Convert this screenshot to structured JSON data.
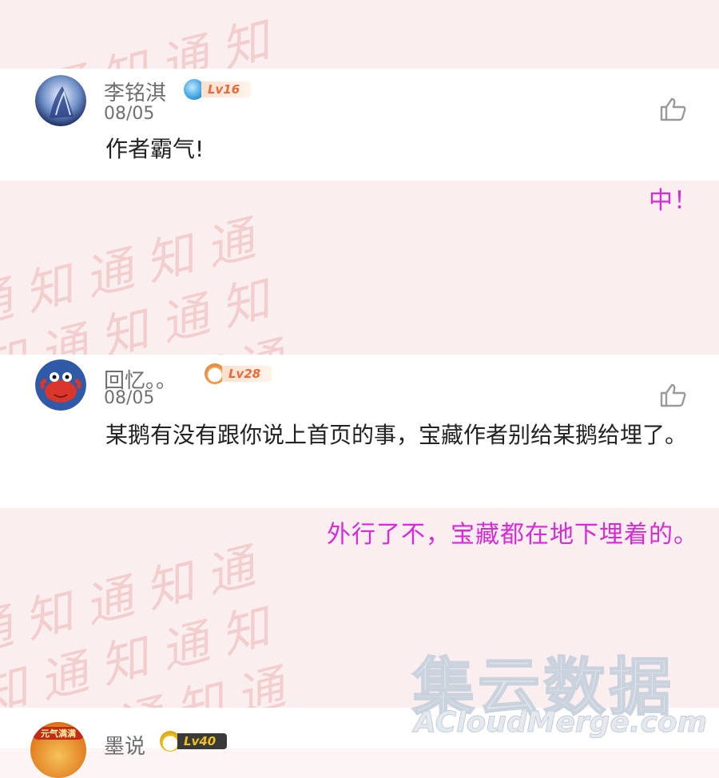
{
  "watermark": {
    "lines": [
      "知通知通知",
      "通知通知通",
      "知通知通知",
      "通知通知通",
      "知通知通知"
    ]
  },
  "comments": [
    {
      "username": "李铭淇",
      "level": "Lv16",
      "date": "08/05",
      "text": "作者霸气!",
      "annotation": "中！"
    },
    {
      "username": "回忆。。",
      "level": "Lv28",
      "date": "08/05",
      "text": "某鹅有没有跟你说上首页的事，宝藏作者别给某鹅给埋了。",
      "annotation": "外行了不，宝藏都在地下埋着的。"
    },
    {
      "username": "墨说",
      "level": "Lv40",
      "badge": "元气满满"
    }
  ],
  "logo": {
    "cn": "集云数据",
    "en": "ACloudMerge.com"
  },
  "colors": {
    "annotation": "#d62bd6",
    "level_tag": "#e66a3a",
    "watermark": "#f2c9c9"
  },
  "icons": {
    "like": "thumbs-up-icon"
  }
}
